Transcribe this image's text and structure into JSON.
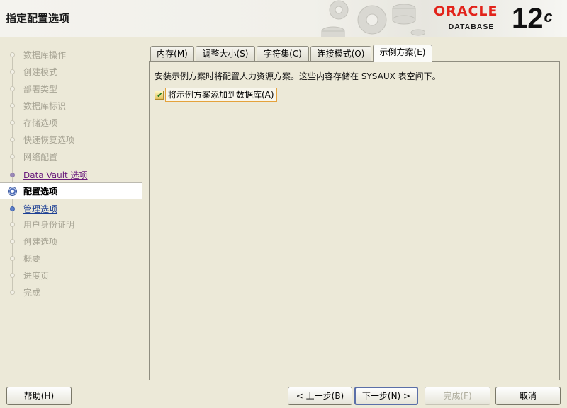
{
  "header": {
    "title": "指定配置选项",
    "brand_oracle": "ORACLE",
    "brand_database": "DATABASE",
    "version": "12",
    "version_suffix": "c"
  },
  "nav": {
    "items": [
      {
        "label": "数据库操作",
        "state": "done"
      },
      {
        "label": "创建模式",
        "state": "done"
      },
      {
        "label": "部署类型",
        "state": "done"
      },
      {
        "label": "数据库标识",
        "state": "done"
      },
      {
        "label": "存储选项",
        "state": "done"
      },
      {
        "label": "快速恢复选项",
        "state": "done"
      },
      {
        "label": "网络配置",
        "state": "done"
      },
      {
        "label": "Data Vault 选项",
        "state": "link"
      },
      {
        "label": "配置选项",
        "state": "active"
      },
      {
        "label": "管理选项",
        "state": "next"
      },
      {
        "label": "用户身份证明",
        "state": "pending"
      },
      {
        "label": "创建选项",
        "state": "pending"
      },
      {
        "label": "概要",
        "state": "pending"
      },
      {
        "label": "进度页",
        "state": "pending"
      },
      {
        "label": "完成",
        "state": "pending"
      }
    ]
  },
  "tabs": [
    {
      "label": "内存(M)",
      "selected": false
    },
    {
      "label": "调整大小(S)",
      "selected": false
    },
    {
      "label": "字符集(C)",
      "selected": false
    },
    {
      "label": "连接模式(O)",
      "selected": false
    },
    {
      "label": "示例方案(E)",
      "selected": true
    }
  ],
  "panel": {
    "description": "安装示例方案时将配置人力资源方案。这些内容存储在 SYSAUX 表空间下。",
    "checkbox_label": "将示例方案添加到数据库(A)",
    "checkbox_checked": true
  },
  "buttons": {
    "help": "帮助(H)",
    "back": "< 上一步(B)",
    "next": "下一步(N) >",
    "finish": "完成(F)",
    "cancel": "取消"
  },
  "colors": {
    "background": "#ece9d8",
    "oracle_red": "#e2231a",
    "link_purple": "#6a1b7c",
    "link_blue": "#1c3f94"
  }
}
